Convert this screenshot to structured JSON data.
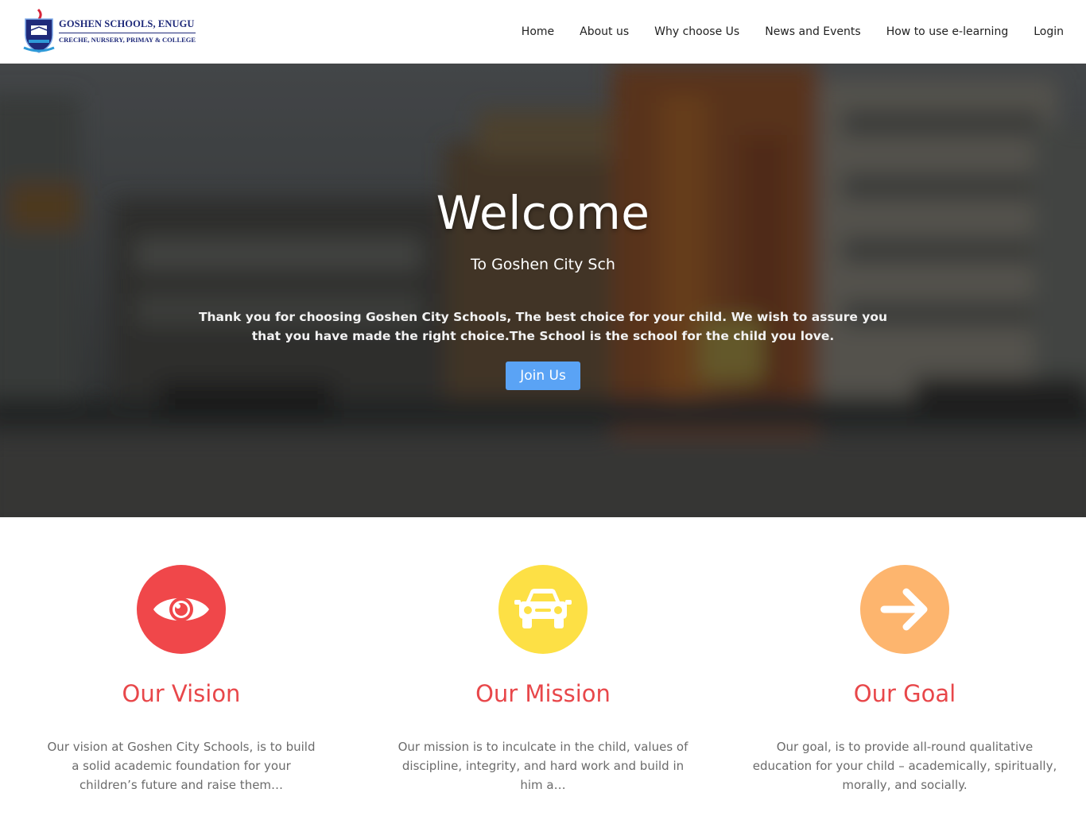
{
  "brand": {
    "name": "GOSHEN SCHOOLS, ENUGU",
    "tagline": "CRECHE, NURSERY, PRIMAY & COLLEGE"
  },
  "nav": {
    "items": [
      "Home",
      "About us",
      "Why choose Us",
      "News and Events",
      "How to use e-learning",
      "Login"
    ]
  },
  "hero": {
    "title": "Welcome",
    "subtitle": "To Goshen City Sch",
    "text": "Thank you for choosing Goshen City Schools, The best choice for your child. We wish to assure you that you have made the right choice.The School is the school for the child you love.",
    "button_label": "Join Us"
  },
  "features": [
    {
      "icon": "eye-icon",
      "color": "#f0474a",
      "title": "Our Vision",
      "text": "Our vision at Goshen City Schools, is to build a solid academic foundation for your children’s future and raise them…"
    },
    {
      "icon": "car-icon",
      "color": "#fde045",
      "title": "Our Mission",
      "text": "Our mission is to inculcate in the child, values of discipline, integrity, and hard work and build in him a…"
    },
    {
      "icon": "arrow-right-icon",
      "color": "#fdb56e",
      "title": "Our Goal",
      "text": "Our goal, is to provide all-round qualitative education for your child – academically, spiritually, morally, and socially."
    }
  ],
  "colors": {
    "accent": "#e8474a",
    "button": "#5aa3f5",
    "brand": "#1f2a7a"
  }
}
